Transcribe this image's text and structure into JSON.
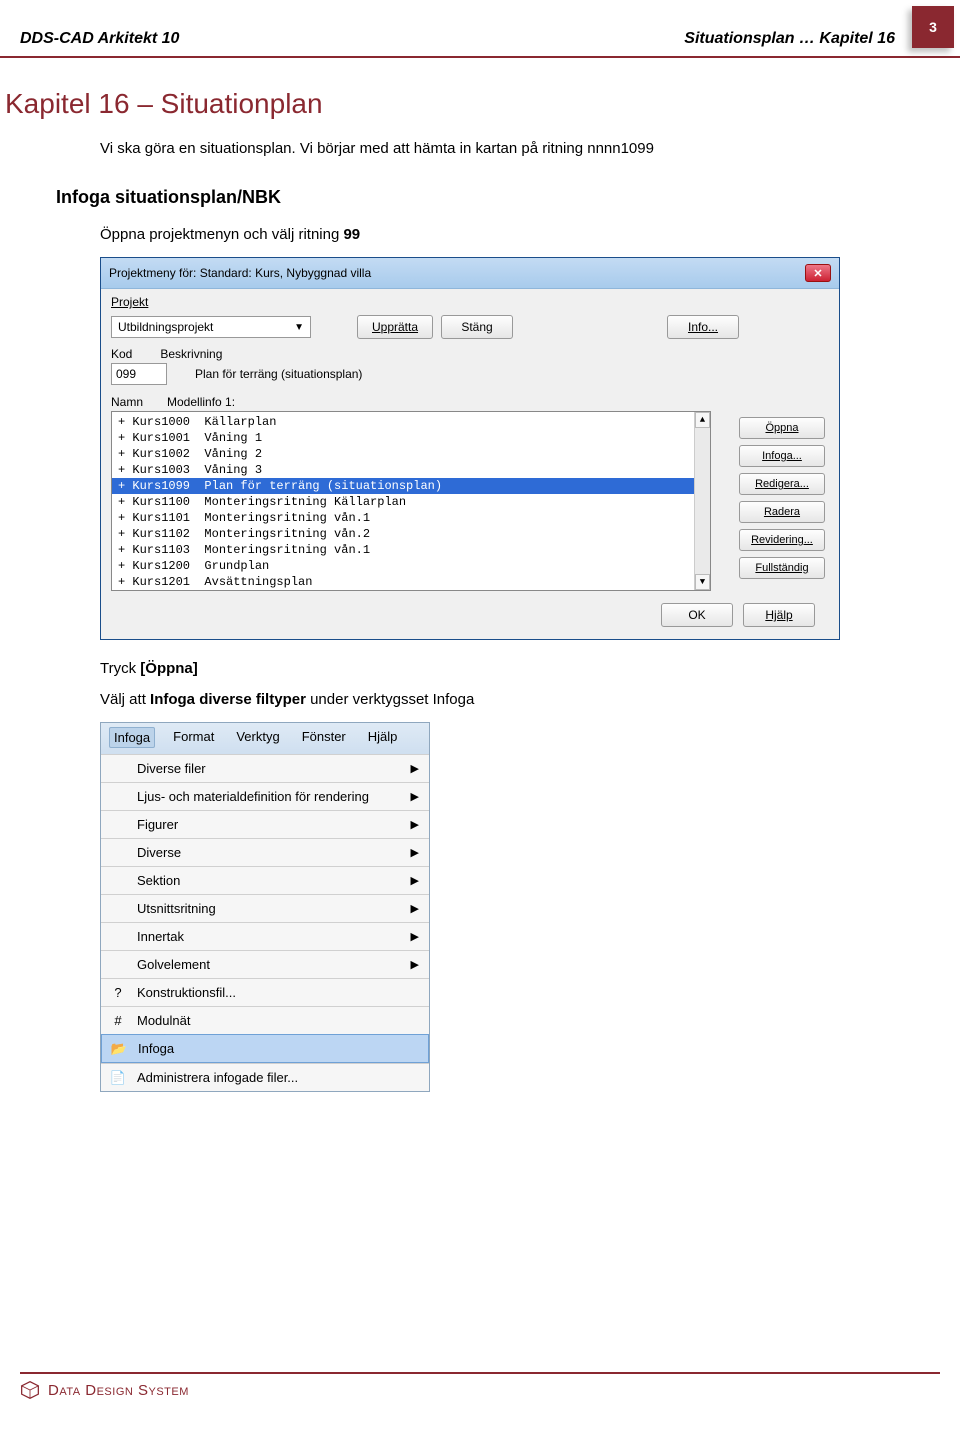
{
  "page_number": "3",
  "header_left": "DDS-CAD Arkitekt 10",
  "header_right_bold": "Situationsplan",
  "header_right_rest": " … Kapitel 16",
  "chapter_title": "Kapitel 16 – Situationplan",
  "intro_text": "Vi ska göra en situationsplan. Vi börjar med att hämta in kartan på ritning nnnn1099",
  "section_title": "Infoga situationsplan/NBK",
  "body_text_1_pre": "Öppna projektmenyn och välj ritning ",
  "body_text_1_bold": "99",
  "dialog": {
    "title": "Projektmeny för:  Standard: Kurs,  Nybyggnad villa",
    "menu_label": "Projekt",
    "project_name": "Utbildningsprojekt",
    "btn_uppratta": "Upprätta",
    "btn_stang": "Stäng",
    "btn_info": "Info...",
    "header_kod": "Kod",
    "header_beskriv": "Beskrivning",
    "kod_value": "099",
    "beskriv_value": "Plan för terräng (situationsplan)",
    "col_namn": "Namn",
    "col_modell": "Modellinfo 1:",
    "rows": [
      "+ Kurs1000  Källarplan",
      "+ Kurs1001  Våning 1",
      "+ Kurs1002  Våning 2",
      "+ Kurs1003  Våning 3",
      "+ Kurs1099  Plan för terräng (situationsplan)",
      "+ Kurs1100  Monteringsritning Källarplan",
      "+ Kurs1101  Monteringsritning vån.1",
      "+ Kurs1102  Monteringsritning vån.2",
      "+ Kurs1103  Monteringsritning vån.1",
      "+ Kurs1200  Grundplan",
      "+ Kurs1201  Avsättningsplan"
    ],
    "selected_index": 4,
    "side_buttons": [
      "Öppna",
      "Infoga...",
      "Redigera...",
      "Radera",
      "Revidering...",
      "Fullständig"
    ],
    "btn_ok": "OK",
    "btn_hjalp": "Hjälp"
  },
  "body_text_2_pre": "Tryck ",
  "body_text_2_bold": "[Öppna]",
  "body_text_3_pre": "Välj att ",
  "body_text_3_bold": "Infoga diverse filtyper",
  "body_text_3_post": " under verktygsset Infoga",
  "menu": {
    "bar": [
      "Infoga",
      "Format",
      "Verktyg",
      "Fönster",
      "Hjälp"
    ],
    "active_index": 0,
    "items": [
      {
        "label": "Diverse filer",
        "sub": true,
        "icon": ""
      },
      {
        "label": "Ljus- och materialdefinition för rendering",
        "sub": true,
        "icon": ""
      },
      {
        "label": "Figurer",
        "sub": true,
        "icon": ""
      },
      {
        "label": "Diverse",
        "sub": true,
        "icon": ""
      },
      {
        "label": "Sektion",
        "sub": true,
        "icon": ""
      },
      {
        "label": "Utsnittsritning",
        "sub": true,
        "icon": ""
      },
      {
        "label": "Innertak",
        "sub": true,
        "icon": ""
      },
      {
        "label": "Golvelement",
        "sub": true,
        "icon": ""
      },
      {
        "label": "Konstruktionsfil...",
        "sub": false,
        "icon": "?"
      },
      {
        "label": "Modulnät",
        "sub": false,
        "icon": "#"
      },
      {
        "label": "Infoga",
        "sub": false,
        "icon": "📂",
        "highlight": true
      },
      {
        "label": "Administrera infogade filer...",
        "sub": false,
        "icon": "📄"
      }
    ]
  },
  "footer_text": "Data Design System"
}
